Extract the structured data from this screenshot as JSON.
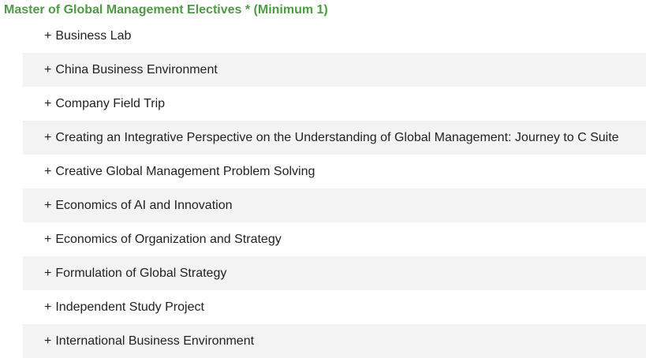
{
  "section": {
    "title": "Master of Global Management Electives * (Minimum 1)",
    "title_color": "#4f9a44"
  },
  "courses": [
    {
      "prefix": "+",
      "label": "Business Lab"
    },
    {
      "prefix": "+",
      "label": "China Business Environment"
    },
    {
      "prefix": "+",
      "label": "Company Field Trip"
    },
    {
      "prefix": "+",
      "label": "Creating an Integrative Perspective on the Understanding of Global Management: Journey to C Suite"
    },
    {
      "prefix": "+",
      "label": "Creative Global Management Problem Solving"
    },
    {
      "prefix": "+",
      "label": "Economics of AI and Innovation"
    },
    {
      "prefix": "+",
      "label": "Economics of Organization and Strategy"
    },
    {
      "prefix": "+",
      "label": "Formulation of Global Strategy"
    },
    {
      "prefix": "+",
      "label": "Independent Study Project"
    },
    {
      "prefix": "+",
      "label": "International Business Environment"
    }
  ],
  "colors": {
    "row_stripe": "#f3f3f3",
    "text": "#222222"
  }
}
